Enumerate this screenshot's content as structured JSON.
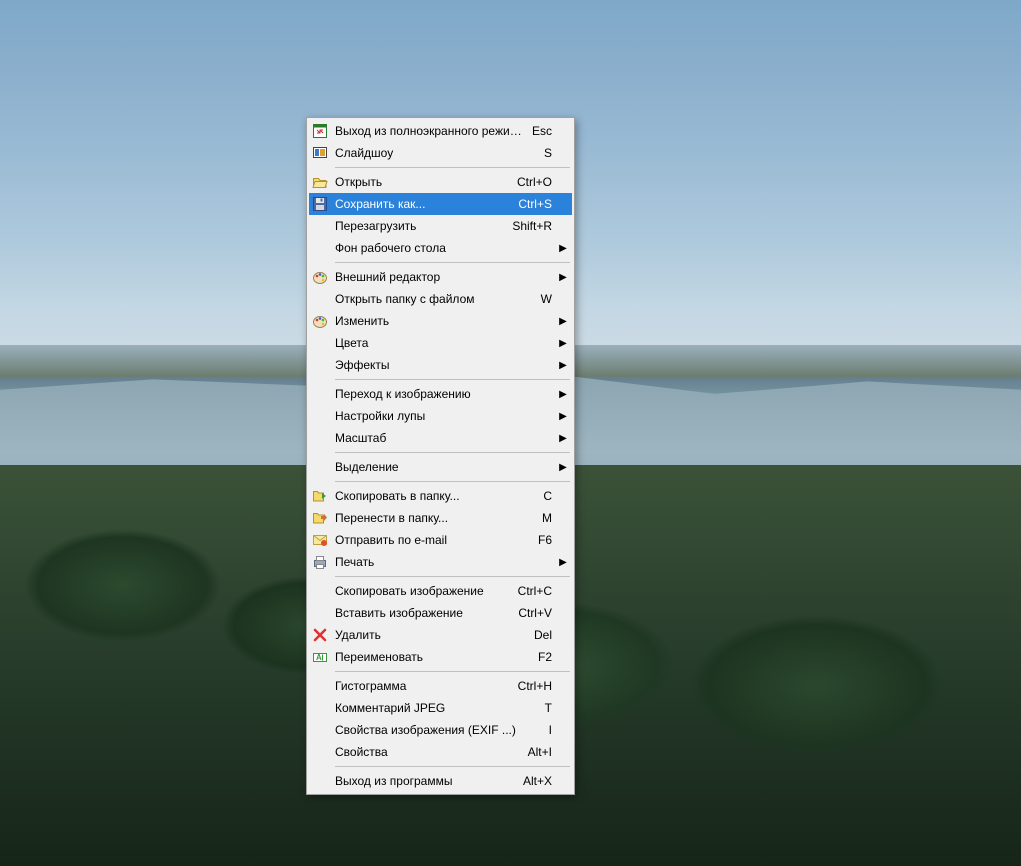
{
  "menu": {
    "items": [
      {
        "icon": "fullscreen-exit",
        "label": "Выход из полноэкранного режима",
        "shortcut": "Esc",
        "submenu": false,
        "highlight": false
      },
      {
        "icon": "slideshow",
        "label": "Слайдшоу",
        "shortcut": "S",
        "submenu": false,
        "highlight": false
      },
      {
        "sep": true
      },
      {
        "icon": "open",
        "label": "Открыть",
        "shortcut": "Ctrl+O",
        "submenu": false,
        "highlight": false
      },
      {
        "icon": "save",
        "label": "Сохранить как...",
        "shortcut": "Ctrl+S",
        "submenu": false,
        "highlight": true
      },
      {
        "icon": "",
        "label": "Перезагрузить",
        "shortcut": "Shift+R",
        "submenu": false,
        "highlight": false
      },
      {
        "icon": "",
        "label": "Фон рабочего стола",
        "shortcut": "",
        "submenu": true,
        "highlight": false
      },
      {
        "sep": true
      },
      {
        "icon": "palette",
        "label": "Внешний редактор",
        "shortcut": "",
        "submenu": true,
        "highlight": false
      },
      {
        "icon": "",
        "label": "Открыть папку с файлом",
        "shortcut": "W",
        "submenu": false,
        "highlight": false
      },
      {
        "icon": "palette",
        "label": "Изменить",
        "shortcut": "",
        "submenu": true,
        "highlight": false
      },
      {
        "icon": "",
        "label": "Цвета",
        "shortcut": "",
        "submenu": true,
        "highlight": false
      },
      {
        "icon": "",
        "label": "Эффекты",
        "shortcut": "",
        "submenu": true,
        "highlight": false
      },
      {
        "sep": true
      },
      {
        "icon": "",
        "label": "Переход к изображению",
        "shortcut": "",
        "submenu": true,
        "highlight": false
      },
      {
        "icon": "",
        "label": "Настройки лупы",
        "shortcut": "",
        "submenu": true,
        "highlight": false
      },
      {
        "icon": "",
        "label": "Масштаб",
        "shortcut": "",
        "submenu": true,
        "highlight": false
      },
      {
        "sep": true
      },
      {
        "icon": "",
        "label": "Выделение",
        "shortcut": "",
        "submenu": true,
        "highlight": false
      },
      {
        "sep": true
      },
      {
        "icon": "copy-folder",
        "label": "Скопировать в папку...",
        "shortcut": "C",
        "submenu": false,
        "highlight": false
      },
      {
        "icon": "move-folder",
        "label": "Перенести в папку...",
        "shortcut": "M",
        "submenu": false,
        "highlight": false
      },
      {
        "icon": "email",
        "label": "Отправить по e-mail",
        "shortcut": "F6",
        "submenu": false,
        "highlight": false
      },
      {
        "icon": "print",
        "label": "Печать",
        "shortcut": "",
        "submenu": true,
        "highlight": false
      },
      {
        "sep": true
      },
      {
        "icon": "",
        "label": "Скопировать изображение",
        "shortcut": "Ctrl+C",
        "submenu": false,
        "highlight": false
      },
      {
        "icon": "",
        "label": "Вставить изображение",
        "shortcut": "Ctrl+V",
        "submenu": false,
        "highlight": false
      },
      {
        "icon": "delete",
        "label": "Удалить",
        "shortcut": "Del",
        "submenu": false,
        "highlight": false
      },
      {
        "icon": "rename",
        "label": "Переименовать",
        "shortcut": "F2",
        "submenu": false,
        "highlight": false
      },
      {
        "sep": true
      },
      {
        "icon": "",
        "label": "Гистограмма",
        "shortcut": "Ctrl+H",
        "submenu": false,
        "highlight": false
      },
      {
        "icon": "",
        "label": "Комментарий JPEG",
        "shortcut": "T",
        "submenu": false,
        "highlight": false
      },
      {
        "icon": "",
        "label": "Свойства изображения (EXIF ...)",
        "shortcut": "I",
        "submenu": false,
        "highlight": false
      },
      {
        "icon": "",
        "label": "Свойства",
        "shortcut": "Alt+I",
        "submenu": false,
        "highlight": false
      },
      {
        "sep": true
      },
      {
        "icon": "",
        "label": "Выход из программы",
        "shortcut": "Alt+X",
        "submenu": false,
        "highlight": false
      }
    ]
  }
}
